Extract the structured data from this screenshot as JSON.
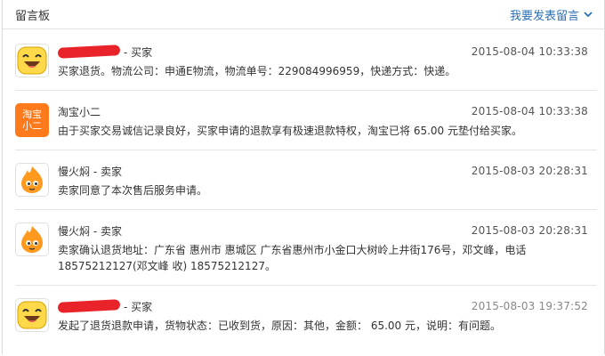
{
  "header": {
    "title": "留言板",
    "action_label": "我要发表留言"
  },
  "messages": [
    {
      "avatar": "smiley-avatar",
      "author": "- 买家",
      "time": "2015-08-04 10:33:38",
      "content": "买家退货。物流公司：申通E物流，物流单号：229084996959，快递方式：快递。"
    },
    {
      "avatar": "taobao-xiaoer-avatar",
      "avatar_text_1": "淘宝",
      "avatar_text_2": "小二",
      "author": "淘宝小二",
      "time": "2015-08-04 10:33:38",
      "content": "由于买家交易诚信记录良好，买家申请的退款享有极速退款特权，淘宝已将 65.00 元垫付给买家。"
    },
    {
      "avatar": "flame-mascot-avatar",
      "author": "慢火焖 - 卖家",
      "time": "2015-08-03 20:28:31",
      "content": "卖家同意了本次售后服务申请。"
    },
    {
      "avatar": "flame-mascot-avatar",
      "author": "慢火焖 - 卖家",
      "time": "2015-08-03 20:28:31",
      "content": "卖家确认退货地址：广东省 惠州市 惠城区 广东省惠州市小金口大树岭上井街176号，邓文峰，电话18575212127(邓文峰 收) 18575212127。"
    },
    {
      "avatar": "smiley-avatar",
      "author": "- 买家",
      "time": "2015-08-03 19:37:52",
      "content": "发起了退货退款申请，货物状态：已收到货，原因：其他，金额： 65.00 元，说明：有问题。"
    }
  ],
  "colors": {
    "link": "#2a6fb7",
    "taobao_orange": "#ff7a1a",
    "redaction": "#e8232a",
    "smiley_yellow": "#ffd94a",
    "flame_orange": "#ff9a1f"
  }
}
